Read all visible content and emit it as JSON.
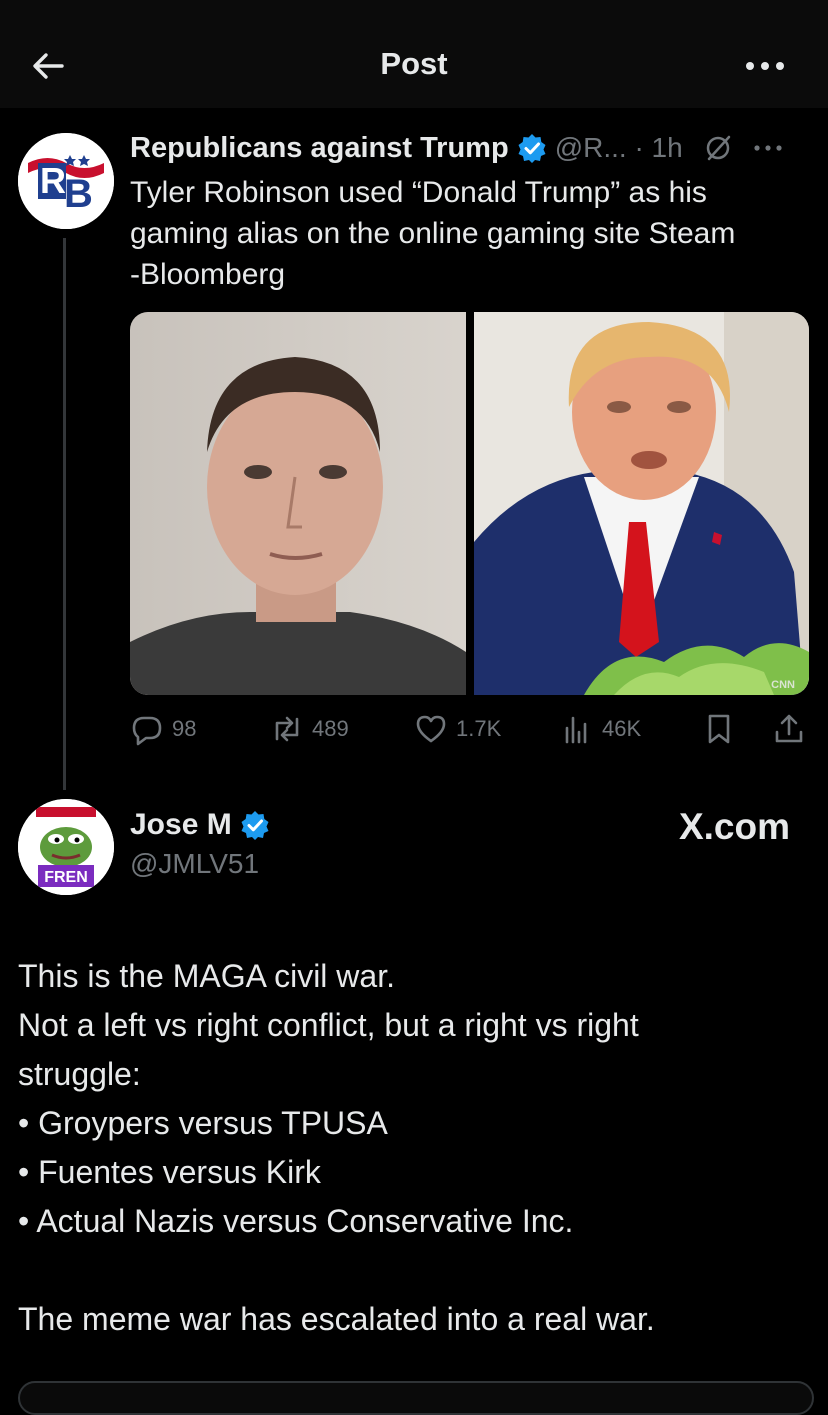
{
  "header": {
    "title": "Post"
  },
  "tweet1": {
    "author_name": "Republicans against Trump",
    "handle_time": "@R... · 1h",
    "avatar_text": "RB",
    "text_lines": [
      "Tyler Robinson used “Donald Trump” as his",
      "gaming alias on the online gaming site Steam",
      "-Bloomberg"
    ],
    "media_watermark": "CNN",
    "stats": {
      "replies": "98",
      "reposts": "489",
      "likes": "1.7K",
      "views": "46K"
    }
  },
  "tweet2": {
    "author_name": "Jose M",
    "handle": "@JMLV51",
    "avatar_caption": "FREN",
    "watermark": "X.com",
    "body_lines": [
      "This is the MAGA civil war.",
      "Not a left vs right conflict, but a right vs right",
      "struggle:",
      "• Groypers versus TPUSA",
      "• Fuentes versus Kirk",
      "• Actual Nazis versus Conservative Inc.",
      "",
      "The meme war has escalated into a real war."
    ]
  },
  "colors": {
    "background": "#000000",
    "text_primary": "#e7e9ea",
    "text_secondary": "#71767b",
    "verified_blue": "#1d9bf0"
  }
}
